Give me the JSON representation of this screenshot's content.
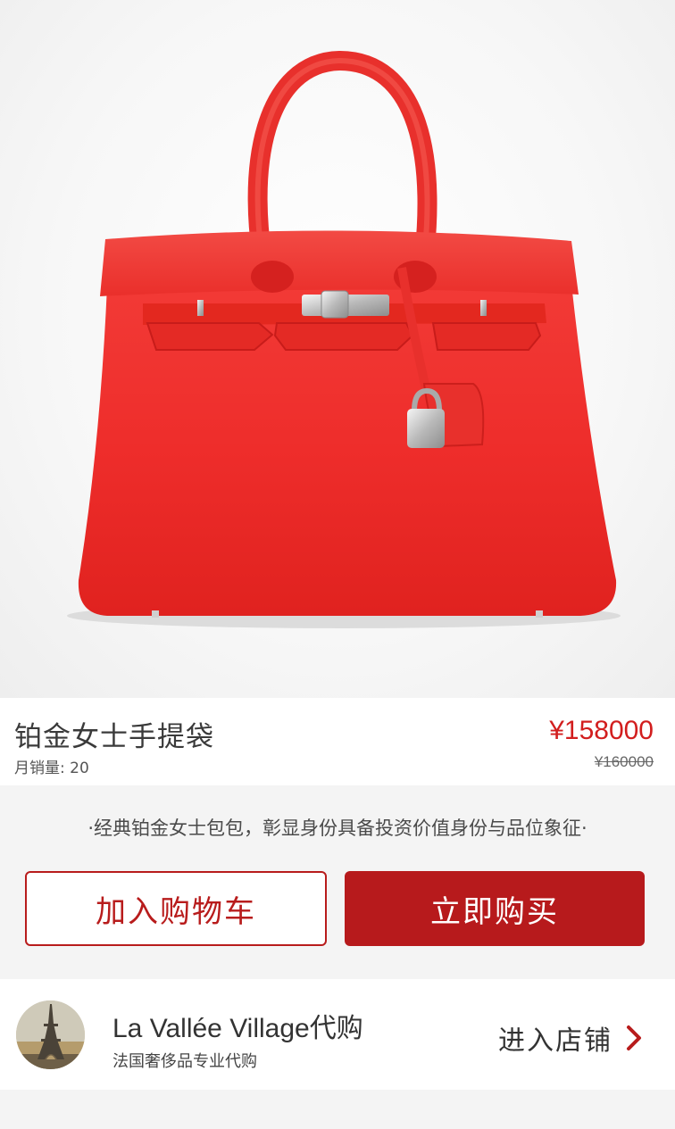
{
  "product": {
    "title": "铂金女士手提袋",
    "sales": "月销量: 20",
    "price": "¥158000",
    "original_price": "¥160000",
    "image_icon": "red-handbag-image"
  },
  "slogan": "·经典铂金女士包包，彰显身份具备投资价值身份与品位象征·",
  "actions": {
    "add_to_cart": "加入购物车",
    "buy_now": "立即购买"
  },
  "store": {
    "name": "La Vallée Village代购",
    "description": "法国奢侈品专业代购",
    "enter_label": "进入店铺",
    "avatar_icon": "eiffel-tower-avatar",
    "chevron_icon": "chevron-right-icon"
  },
  "colors": {
    "accent": "#b71a1c",
    "price": "#d21e1e",
    "bag": "#ee2b2b"
  }
}
